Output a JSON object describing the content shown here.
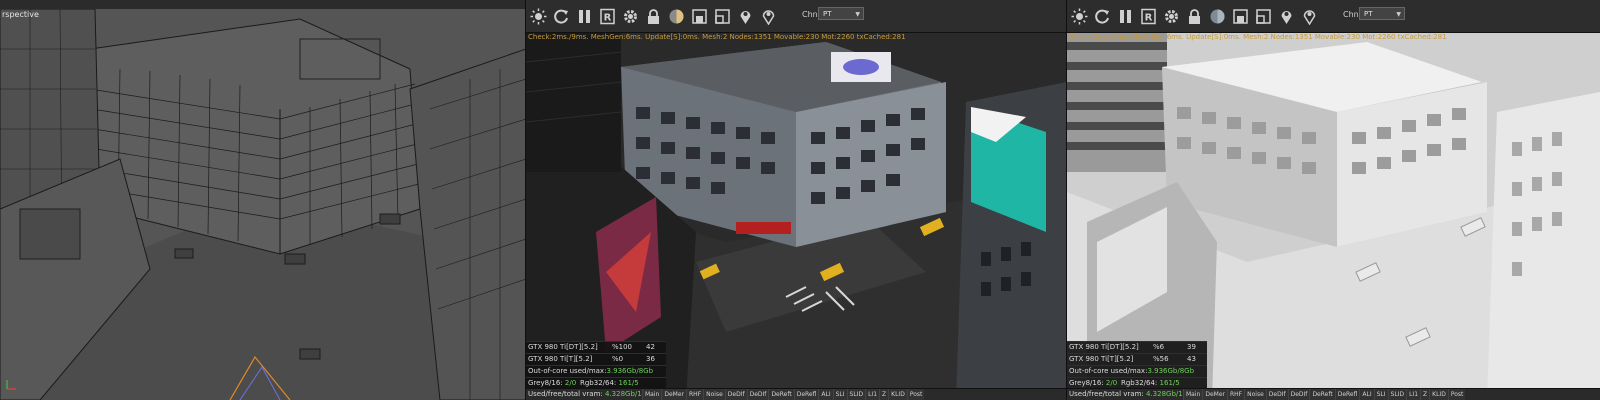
{
  "left_viewport": {
    "label": "rspective"
  },
  "render_viewport": {
    "channel_label": "Chn:",
    "channel_value": "PT",
    "status": "Check:2ms./9ms. MeshGen:6ms. Update[S]:0ms. Mesh:2 Nodes:1351 Movable:230 Mot:2260 txCached:281",
    "stats": {
      "gpu1": "GTX 980 Ti[DT][5.2]",
      "gpu1_pct": "%100",
      "gpu1_temp": "42",
      "gpu2": "GTX 980 Ti[T][5.2]",
      "gpu2_pct": "%0",
      "gpu2_temp": "36",
      "ooc_label": "Out-of-core used/max:",
      "ooc_value": "3.936Gb/8Gb",
      "grey_label": "Grey8/16:",
      "grey_value": "2/0",
      "rgb_label": "Rgb32/64:",
      "rgb_value": "161/5",
      "vram_label": "Used/free/total vram:",
      "vram_value": "4.328Gb/104Mb/6Gb"
    },
    "tabs": [
      "Main",
      "DeMer",
      "RHF",
      "Noise",
      "DeDIf",
      "DeDIf",
      "DeReft",
      "DeRefl",
      "ALI",
      "SLI",
      "SLID",
      "LI1",
      "Z",
      "KLID",
      "Post"
    ]
  },
  "clay_viewport": {
    "channel_label": "Chn:",
    "channel_value": "PT",
    "status": "Check:2ms./9ms. MeshGen:6ms. Update[S]:0ms. Mesh:2 Nodes:1351 Movable:230 Mot:2260 txCached:281",
    "stats": {
      "gpu1": "GTX 980 Ti[DT][5.2]",
      "gpu1_pct": "%6",
      "gpu1_temp": "39",
      "gpu2": "GTX 980 Ti[T][5.2]",
      "gpu2_pct": "%56",
      "gpu2_temp": "43",
      "ooc_label": "Out-of-core used/max:",
      "ooc_value": "3.936Gb/8Gb",
      "grey_label": "Grey8/16:",
      "grey_value": "2/0",
      "rgb_label": "Rgb32/64:",
      "rgb_value": "161/5",
      "vram_label": "Used/free/total vram:",
      "vram_value": "4.328Gb/103Mb/6Gb"
    },
    "tabs": [
      "Main",
      "DeMer",
      "RHF",
      "Noise",
      "DeDIf",
      "DeDIf",
      "DeReft",
      "DeRefl",
      "ALI",
      "SLI",
      "SLID",
      "LI1",
      "Z",
      "KLID",
      "Post"
    ]
  },
  "colors": {
    "status_text": "#c79b3a",
    "stat_value": "#6fcf5b",
    "render_bg": "#232323",
    "wire_bg": "#5a5a5a",
    "clay_bg": "#d8d8d8"
  },
  "toolbar_icons": [
    "brightness-icon",
    "refresh-icon",
    "pause-icon",
    "region-icon",
    "settings-icon",
    "lock-icon",
    "material-sphere-icon",
    "clay-mode-icon",
    "film-region-icon",
    "pick-focus-icon",
    "pick-material-icon"
  ]
}
